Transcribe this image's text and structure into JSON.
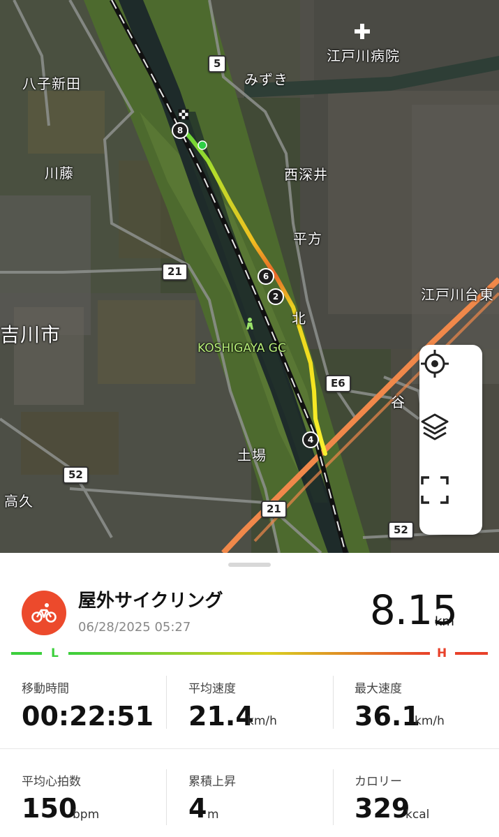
{
  "map": {
    "labels": {
      "hachijo": "八子新田",
      "kawafuji": "川藤",
      "yoshikawa": "吉川市",
      "takaku": "高久",
      "mizuki": "みずき",
      "nishifukai": "西深井",
      "hirakata": "平方",
      "edogawadai": "江戸川台東",
      "hospital": "江戸川病院",
      "doba": "土場",
      "tani": "谷",
      "kita": "北",
      "golf": "KOSHIGAYA GC"
    },
    "route_shields": {
      "r5": "5",
      "r21a": "21",
      "r21b": "21",
      "r52a": "52",
      "r52b": "52",
      "e6": "E6"
    },
    "markers": {
      "m8": "8",
      "m6": "6",
      "m2": "2",
      "m4": "4"
    },
    "controls": [
      "locate-icon",
      "layers-icon",
      "fullscreen-icon"
    ]
  },
  "activity": {
    "title": "屋外サイクリング",
    "datetime": "06/28/2025 05:27",
    "distance": "8.15",
    "distance_unit": "km",
    "speed_scale_low": "L",
    "speed_scale_high": "H",
    "colors": {
      "accent": "#ec4a2c",
      "low": "#3ccf3c",
      "high": "#e8412a"
    }
  },
  "stats": {
    "moving_time": {
      "label": "移動時間",
      "value": "00:22:51",
      "unit": ""
    },
    "avg_speed": {
      "label": "平均速度",
      "value": "21.4",
      "unit": "km/h"
    },
    "max_speed": {
      "label": "最大速度",
      "value": "36.1",
      "unit": "km/h"
    },
    "avg_hr": {
      "label": "平均心拍数",
      "value": "150",
      "unit": "bpm"
    },
    "elevation_gain": {
      "label": "累積上昇",
      "value": "4",
      "unit": "m"
    },
    "calories": {
      "label": "カロリー",
      "value": "329",
      "unit": "kcal"
    }
  }
}
